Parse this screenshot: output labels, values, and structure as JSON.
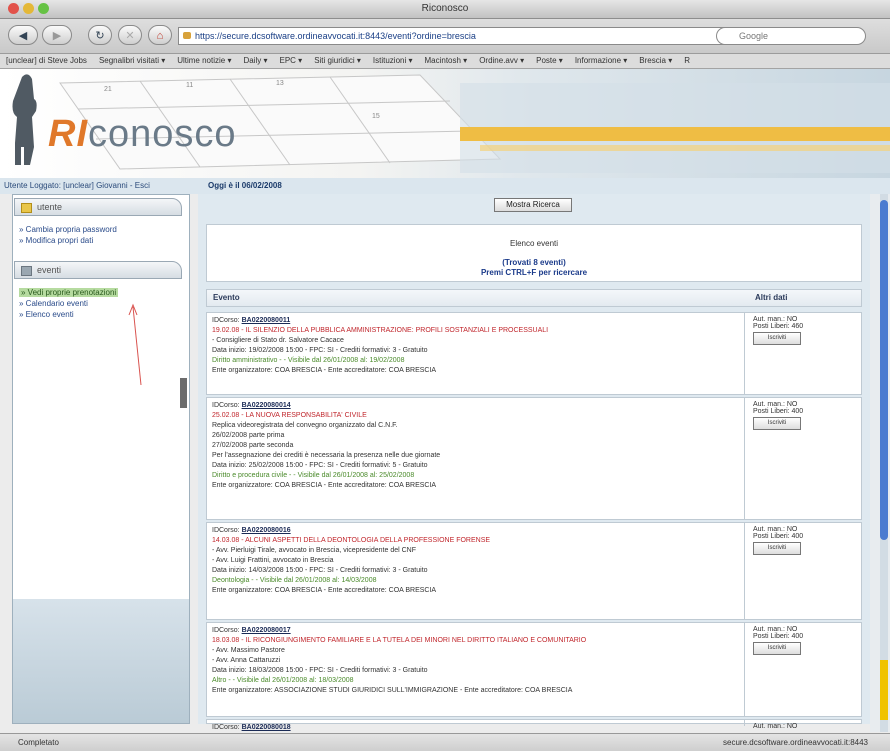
{
  "window": {
    "title": "Riconosco"
  },
  "browser": {
    "url": "https://secure.dcsoftware.ordineavvocati.it:8443/eventi?ordine=brescia",
    "search_placeholder": "Google",
    "bookmarks": [
      "[unclear] di Steve Jobs",
      "Segnalibri visitati ▾",
      "Ultime notizie ▾",
      "Daily ▾",
      "EPC ▾",
      "Siti giuridici ▾",
      "Istituzioni ▾",
      "Macintosh ▾",
      "Ordine.avv ▾",
      "Poste ▾",
      "Informazione ▾",
      "Brescia ▾",
      "R"
    ]
  },
  "banner": {
    "logo_ri": "RI",
    "logo_rest": "conosco"
  },
  "infobar": {
    "user_text": "Utente Loggato: [unclear] Giovanni - Esci",
    "date_text": "Oggi è il 06/02/2008"
  },
  "sidebar": {
    "section1_title": "utente",
    "section1_links": [
      "Cambia propria password",
      "Modifica propri dati"
    ],
    "section2_title": "eventi",
    "section2_links": [
      "Vedi proprie prenotazioni",
      "Calendario eventi",
      "Elenco eventi"
    ]
  },
  "main": {
    "top_button": "Mostra Ricerca",
    "info_title": "Elenco eventi",
    "info_found": "(Trovati 8 eventi)",
    "info_hint": "Premi CTRL+F per ricercare",
    "col_event": "Evento",
    "col_other": "Altri dati",
    "rows": [
      {
        "code_label": "IDCorso:",
        "code": "BA0220080011",
        "title_line": "19.02.08 - IL SILENZIO DELLA PUBBLICA AMMINISTRAZIONE: PROFILI SOSTANZIALI E PROCESSUALI",
        "lines": [
          "- Consigliere di Stato dr. Salvatore Cacace",
          "Data inizio: 19/02/2008 15:00 - FPC: SI - Crediti formativi: 3 - Gratuito"
        ],
        "green_line": "Diritto amministrativo - - Visibile dal 26/01/2008 al: 19/02/2008",
        "lines_after": [
          "Ente organizzatore: COA BRESCIA - Ente accreditatore: COA BRESCIA"
        ],
        "other": [
          "Aut. man.: NO",
          "Posti Liberi: 460"
        ],
        "other_btn": "Iscriviti"
      },
      {
        "code_label": "IDCorso:",
        "code": "BA0220080014",
        "title_line": "25.02.08 - LA NUOVA RESPONSABILITA' CIVILE",
        "lines": [
          "Replica videoregistrata del convegno organizzato dal C.N.F.",
          "26/02/2008 parte prima",
          "27/02/2008 parte seconda",
          "Per l'assegnazione dei crediti è necessaria la presenza nelle due giornate",
          "Data inizio: 25/02/2008 15:00 - FPC: SI - Crediti formativi: 5 - Gratuito"
        ],
        "green_line": "Diritto e procedura civile - - Visibile dal 26/01/2008 al: 25/02/2008",
        "lines_after": [
          "Ente organizzatore: COA BRESCIA - Ente accreditatore: COA BRESCIA"
        ],
        "other": [
          "Aut. man.: NO",
          "Posti Liberi: 400"
        ],
        "other_btn": "Iscriviti"
      },
      {
        "code_label": "IDCorso:",
        "code": "BA0220080016",
        "title_line": "14.03.08 - ALCUNI ASPETTI DELLA DEONTOLOGIA DELLA PROFESSIONE FORENSE",
        "lines": [
          "- Avv. Pierluigi Tirale, avvocato in Brescia, vicepresidente del CNF",
          "- Avv. Luigi Frattini, avvocato in Brescia",
          "Data inizio: 14/03/2008 15:00 - FPC: SI - Crediti formativi: 3 - Gratuito"
        ],
        "green_line": "Deontologia - - Visibile dal 26/01/2008 al: 14/03/2008",
        "lines_after": [
          "Ente organizzatore: COA BRESCIA - Ente accreditatore: COA BRESCIA"
        ],
        "other": [
          "Aut. man.: NO",
          "Posti Liberi: 400"
        ],
        "other_btn": "Iscriviti"
      },
      {
        "code_label": "IDCorso:",
        "code": "BA0220080017",
        "title_line": "18.03.08 - IL RICONGIUNGIMENTO FAMILIARE E LA TUTELA DEI MINORI NEL DIRITTO ITALIANO E COMUNITARIO",
        "lines": [
          "- Avv. Massimo Pastore",
          "- Avv. Anna Cattaruzzi",
          "Data inizio: 18/03/2008 15:00 - FPC: SI - Crediti formativi: 3 - Gratuito"
        ],
        "green_line": "Altro - - Visibile dal 26/01/2008 al: 18/03/2008",
        "lines_after": [
          "Ente organizzatore: ASSOCIAZIONE STUDI GIURIDICI SULL'IMMIGRAZIONE - Ente accreditatore: COA BRESCIA"
        ],
        "other": [
          "Aut. man.: NO",
          "Posti Liberi: 400"
        ],
        "other_btn": "Iscriviti"
      },
      {
        "code_label": "IDCorso:",
        "code": "BA0220080018",
        "title_line": "",
        "lines": [],
        "green_line": "",
        "lines_after": [],
        "other": [
          "Aut. man.: NO"
        ],
        "other_btn": ""
      }
    ]
  },
  "status": {
    "left": "Completato",
    "right": "secure.dcsoftware.ordineavvocati.it:8443"
  }
}
